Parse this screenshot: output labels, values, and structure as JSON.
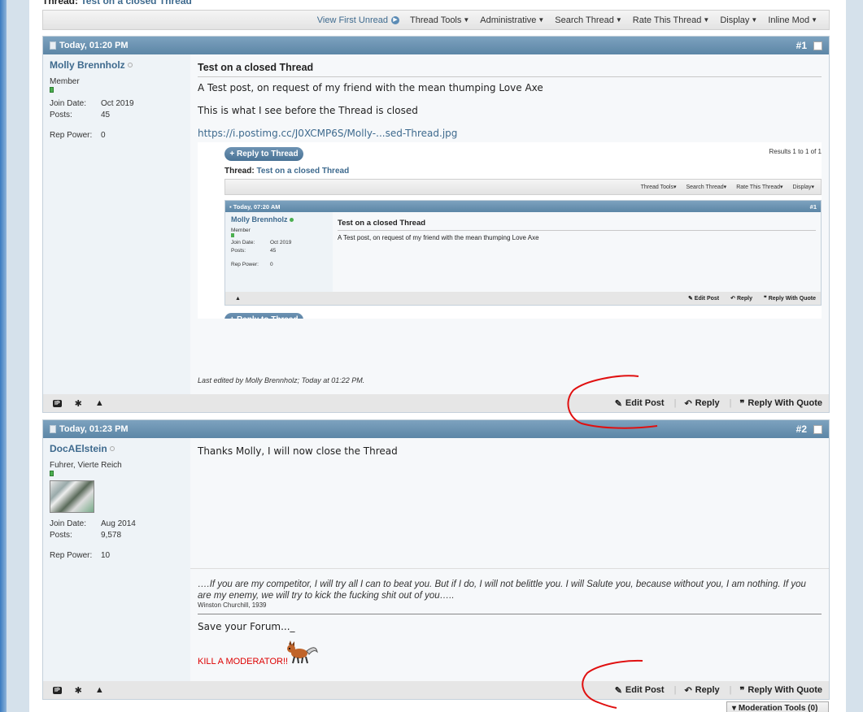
{
  "thread_title": {
    "prefix": "Thread:",
    "title": "Test on a closed Thread"
  },
  "toolbar": {
    "view_first_unread": "View First Unread",
    "thread_tools": "Thread Tools",
    "administrative": "Administrative",
    "search_thread": "Search Thread",
    "rate_thread": "Rate This Thread",
    "display": "Display",
    "inline_mod": "Inline Mod"
  },
  "posts": [
    {
      "date": "Today, 01:20 PM",
      "number": "#1",
      "username": "Molly Brennholz",
      "usertitle": "Member",
      "join_label": "Join Date:",
      "join_date": "Oct 2019",
      "posts_label": "Posts:",
      "posts_count": "45",
      "rep_label": "Rep Power:",
      "rep_power": "0",
      "title": "Test on a closed Thread",
      "paragraphs": [
        "A Test post, on request of my friend with the mean thumping Love Axe",
        "This is what I see before the Thread is closed"
      ],
      "link": "https://i.postimg.cc/J0XCMP6S/Molly-...sed-Thread.jpg",
      "edited": "Last edited by Molly Brennholz; Today at 01:22 PM."
    },
    {
      "date": "Today, 01:23 PM",
      "number": "#2",
      "username": "DocAElstein",
      "usertitle": "Fuhrer, Vierte Reich",
      "join_label": "Join Date:",
      "join_date": "Aug 2014",
      "posts_label": "Posts:",
      "posts_count": "9,578",
      "rep_label": "Rep Power:",
      "rep_power": "10",
      "text": "Thanks Molly, I will now close the Thread",
      "signature": {
        "quote": "….If you are my competitor, I will try all I can to beat you. But if I do, I will not belittle you. I will Salute you, because without you, I am nothing. If you are my enemy, we will try to kick the fucking shit out of you…..",
        "source": "Winston Churchill, 1939",
        "save": "Save your Forum..._",
        "kill": "KILL A MODERATOR!!"
      }
    }
  ],
  "footer": {
    "ip": "IP",
    "edit_post": "Edit Post",
    "reply": "Reply",
    "reply_with_quote": "Reply With Quote"
  },
  "embedded": {
    "reply_to_thread": "+ Reply to Thread",
    "results": "Results 1 to 1 of 1",
    "thread_prefix": "Thread:",
    "thread_title": "Test on a closed Thread",
    "tools": [
      "Thread Tools",
      "Search Thread",
      "Rate This Thread",
      "Display"
    ],
    "date": "Today, 07:20 AM",
    "number": "#1",
    "username": "Molly Brennholz",
    "usertitle": "Member",
    "join_label": "Join Date:",
    "join_date": "Oct 2019",
    "posts_label": "Posts:",
    "posts_count": "45",
    "rep_label": "Rep Power:",
    "rep_power": "0",
    "title": "Test on a closed Thread",
    "text": "A Test post, on request of my friend with the mean thumping Love Axe",
    "edit_post": "Edit Post",
    "reply": "Reply",
    "reply_with_quote": "Reply With Quote"
  },
  "moderation_tools": "Moderation Tools (0)",
  "colors": {
    "header_blue": "#5c86a6",
    "link_blue": "#3e6a8e",
    "annotation_red": "#e01010",
    "kill_red": "#dd0000"
  }
}
